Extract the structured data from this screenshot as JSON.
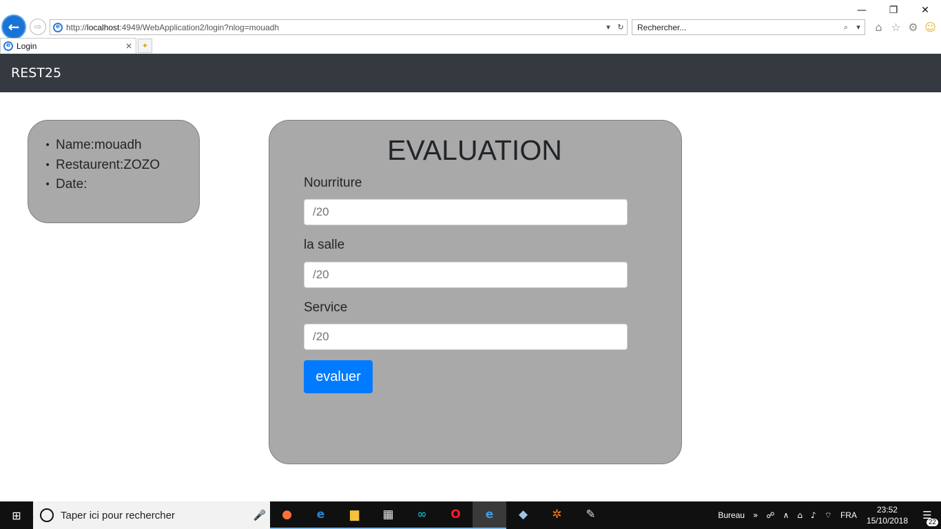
{
  "window": {
    "minimize_icon": "—",
    "restore_icon": "❐",
    "close_icon": "✕"
  },
  "browser": {
    "back_icon": "←",
    "forward_icon": "⇨",
    "url_prefix": "http://",
    "url_host": "localhost",
    "url_rest": ":4949/WebApplication2/login?nlog=mouadh",
    "dropdown_icon": "▾",
    "refresh_icon": "↻",
    "search_placeholder": "Rechercher...",
    "search_icon": "⌕",
    "tool_icons": [
      "⌂",
      "☆",
      "⚙",
      "☺"
    ],
    "tab_title": "Login",
    "tab_close": "✕"
  },
  "navbar": {
    "brand": "REST25"
  },
  "info": {
    "items": [
      {
        "bullet": "•",
        "text": "Name:mouadh"
      },
      {
        "bullet": "•",
        "text": "Restaurent:ZOZO"
      },
      {
        "bullet": "•",
        "text": "Date:"
      }
    ]
  },
  "evaluation": {
    "title": "EVALUATION",
    "fields": [
      {
        "label": "Nourriture",
        "placeholder": "/20"
      },
      {
        "label": "la salle",
        "placeholder": "/20"
      },
      {
        "label": "Service",
        "placeholder": "/20"
      }
    ],
    "submit_label": "evaluer"
  },
  "taskbar": {
    "start_icon": "⊞",
    "search_placeholder": "Taper ici pour rechercher",
    "mic_icon": "🎤",
    "apps": [
      {
        "name": "firefox",
        "glyph": "●",
        "color": "#ff7139"
      },
      {
        "name": "edge",
        "glyph": "e",
        "color": "#2a83d6"
      },
      {
        "name": "file-explorer",
        "glyph": "▆",
        "color": "#f4c23b"
      },
      {
        "name": "store",
        "glyph": "▦",
        "color": "#e8e8e8"
      },
      {
        "name": "arduino",
        "glyph": "∞",
        "color": "#12a3b6"
      },
      {
        "name": "opera",
        "glyph": "O",
        "color": "#ff1b2d"
      },
      {
        "name": "internet-explorer",
        "glyph": "e",
        "color": "#3f9be5"
      },
      {
        "name": "virtualbox",
        "glyph": "◆",
        "color": "#9fc3e6"
      },
      {
        "name": "xampp",
        "glyph": "✲",
        "color": "#fb7a24"
      },
      {
        "name": "paint",
        "glyph": "✎",
        "color": "#d8d8d8"
      }
    ],
    "desktop_label": "Bureau",
    "desktop_chevron": "»",
    "people_icon": "☍",
    "tray_up_icon": "∧",
    "network_icon": "⌂",
    "volume_icon": "♪",
    "wifi_icon": "⌔",
    "language": "FRA",
    "time": "23:52",
    "date": "15/10/2018",
    "notification_icon": "☰",
    "notification_count": "22"
  }
}
